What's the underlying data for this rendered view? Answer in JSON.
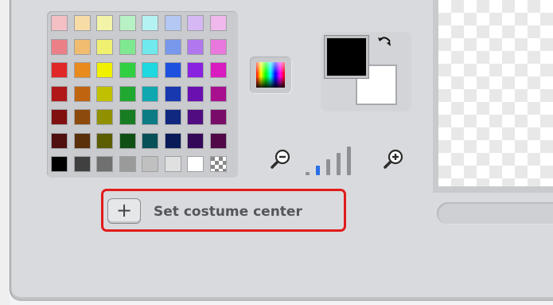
{
  "palette": {
    "rows": [
      [
        "#f4c0c4",
        "#f7dca6",
        "#f4f4a8",
        "#b8f2c4",
        "#b4f2f4",
        "#b4c8f4",
        "#d6b8f4",
        "#f0b8ec"
      ],
      [
        "#ec8088",
        "#f0bc70",
        "#f0f070",
        "#80e890",
        "#70e8ec",
        "#7898ec",
        "#b078ec",
        "#e878dc"
      ],
      [
        "#e02828",
        "#e88a1c",
        "#f0f000",
        "#30d040",
        "#20d8e0",
        "#1e50e0",
        "#8a20e0",
        "#d81cc0"
      ],
      [
        "#b01818",
        "#c06410",
        "#c0c000",
        "#20a830",
        "#10a8b0",
        "#1838b0",
        "#6a10b0",
        "#a81090"
      ],
      [
        "#801010",
        "#8c4a0c",
        "#909000",
        "#187c20",
        "#0c7c84",
        "#102880",
        "#500c80",
        "#780c68"
      ],
      [
        "#501010",
        "#5a300a",
        "#5c5c00",
        "#105014",
        "#085058",
        "#081a58",
        "#340858",
        "#500848"
      ],
      [
        "#000000",
        "#404040",
        "#707070",
        "#9a9a9a",
        "#c0c0c0",
        "#e0e0e0",
        "#ffffff",
        "transparent"
      ]
    ]
  },
  "colors": {
    "foreground": "#000000",
    "background": "#ffffff",
    "highlight": "#e01b1b"
  },
  "zoom": {
    "levels": 5,
    "active_level": 2
  },
  "icons": {
    "swap": "swap-colors-icon",
    "zoom_out": "zoom-out-icon",
    "zoom_in": "zoom-in-icon",
    "set_center": "crosshair-plus-icon",
    "picker": "color-picker-icon"
  },
  "set_center": {
    "label": "Set costume center",
    "icon_glyph": "+"
  }
}
